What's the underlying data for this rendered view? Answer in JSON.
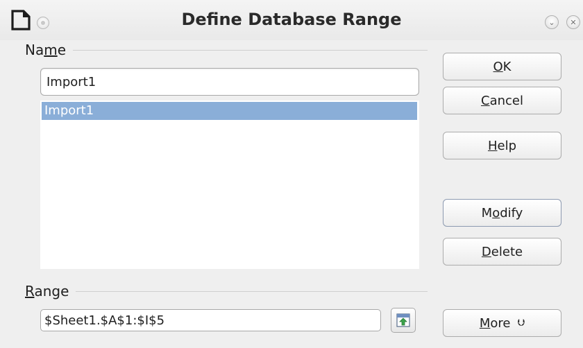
{
  "title": "Define Database Range",
  "name_group": {
    "label_pre": "Na",
    "label_mn": "m",
    "label_post": "e"
  },
  "name_input": {
    "value": "Import1"
  },
  "name_list": [
    "Import1"
  ],
  "range_group": {
    "label_mn": "R",
    "label_post": "ange"
  },
  "range_input": {
    "value": "$Sheet1.$A$1:$I$5"
  },
  "buttons": {
    "ok": {
      "mn": "O",
      "rest": "K"
    },
    "cancel": {
      "mn": "C",
      "rest": "ancel"
    },
    "help": {
      "mn": "H",
      "rest": "elp"
    },
    "modify": {
      "pre": "M",
      "mn": "o",
      "rest": "dify"
    },
    "delete": {
      "mn": "D",
      "rest": "elete"
    },
    "more": {
      "mn": "M",
      "rest": "ore",
      "arrow": "⮋"
    }
  },
  "colors": {
    "selection": "#8aaed8",
    "background": "#efefef"
  }
}
